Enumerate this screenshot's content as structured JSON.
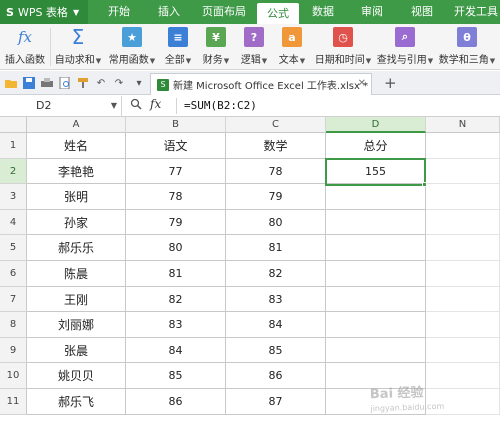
{
  "app": {
    "name": "WPS 表格",
    "logo": "S"
  },
  "tabs": [
    {
      "label": "开始"
    },
    {
      "label": "插入"
    },
    {
      "label": "页面布局"
    },
    {
      "label": "公式",
      "active": true
    },
    {
      "label": "数据"
    },
    {
      "label": "审阅"
    },
    {
      "label": "视图"
    },
    {
      "label": "开发工具"
    }
  ],
  "ribbon": {
    "insert_function": {
      "label": "插入函数",
      "icon": "fx-icon"
    },
    "autosum": {
      "label": "自动求和",
      "icon": "sigma-icon"
    },
    "common": {
      "label": "常用函数",
      "icon": "star-icon",
      "color": "#4a9fd8"
    },
    "all": {
      "label": "全部",
      "icon": "list-icon",
      "color": "#3b7fd6"
    },
    "finance": {
      "label": "财务",
      "icon": "finance-icon",
      "color": "#5aa653"
    },
    "logic": {
      "label": "逻辑",
      "icon": "question-icon",
      "color": "#a06cc8"
    },
    "text": {
      "label": "文本",
      "icon": "text-a-icon",
      "color": "#f0973a"
    },
    "datetime": {
      "label": "日期和时间",
      "icon": "clock-icon",
      "color": "#e0524c"
    },
    "lookup": {
      "label": "查找与引用",
      "icon": "search-doc-icon",
      "color": "#9a6bd1"
    },
    "math": {
      "label": "数学和三角",
      "icon": "theta-icon",
      "color": "#7f7fd8"
    }
  },
  "document": {
    "tab_title": "新建 Microsoft Office Excel 工作表.xlsx *"
  },
  "formula_bar": {
    "name_box": "D2",
    "formula": "=SUM(B2:C2)",
    "fx": "fx"
  },
  "grid": {
    "columns": [
      "A",
      "B",
      "C",
      "D",
      "N"
    ],
    "rows": [
      "1",
      "2",
      "3",
      "4",
      "5",
      "6",
      "7",
      "8",
      "9",
      "10",
      "11"
    ],
    "headers": [
      "姓名",
      "语文",
      "数学",
      "总分"
    ],
    "data": [
      {
        "name": "李艳艳",
        "chinese": "77",
        "math": "78",
        "total": "155"
      },
      {
        "name": "张明",
        "chinese": "78",
        "math": "79",
        "total": ""
      },
      {
        "name": "孙家",
        "chinese": "79",
        "math": "80",
        "total": ""
      },
      {
        "name": "郝乐乐",
        "chinese": "80",
        "math": "81",
        "total": ""
      },
      {
        "name": "陈晨",
        "chinese": "81",
        "math": "82",
        "total": ""
      },
      {
        "name": "王刚",
        "chinese": "82",
        "math": "83",
        "total": ""
      },
      {
        "name": "刘丽娜",
        "chinese": "83",
        "math": "84",
        "total": ""
      },
      {
        "name": "张晨",
        "chinese": "84",
        "math": "85",
        "total": ""
      },
      {
        "name": "姚贝贝",
        "chinese": "85",
        "math": "86",
        "total": ""
      },
      {
        "name": "郝乐飞",
        "chinese": "86",
        "math": "87",
        "total": ""
      }
    ],
    "active_cell": "D2"
  },
  "watermark": {
    "text": "Bai 经验",
    "sub": "jingyan.baidu.com"
  },
  "colors": {
    "accent": "#3f9a48",
    "tab_bar": "#3f9a48"
  }
}
